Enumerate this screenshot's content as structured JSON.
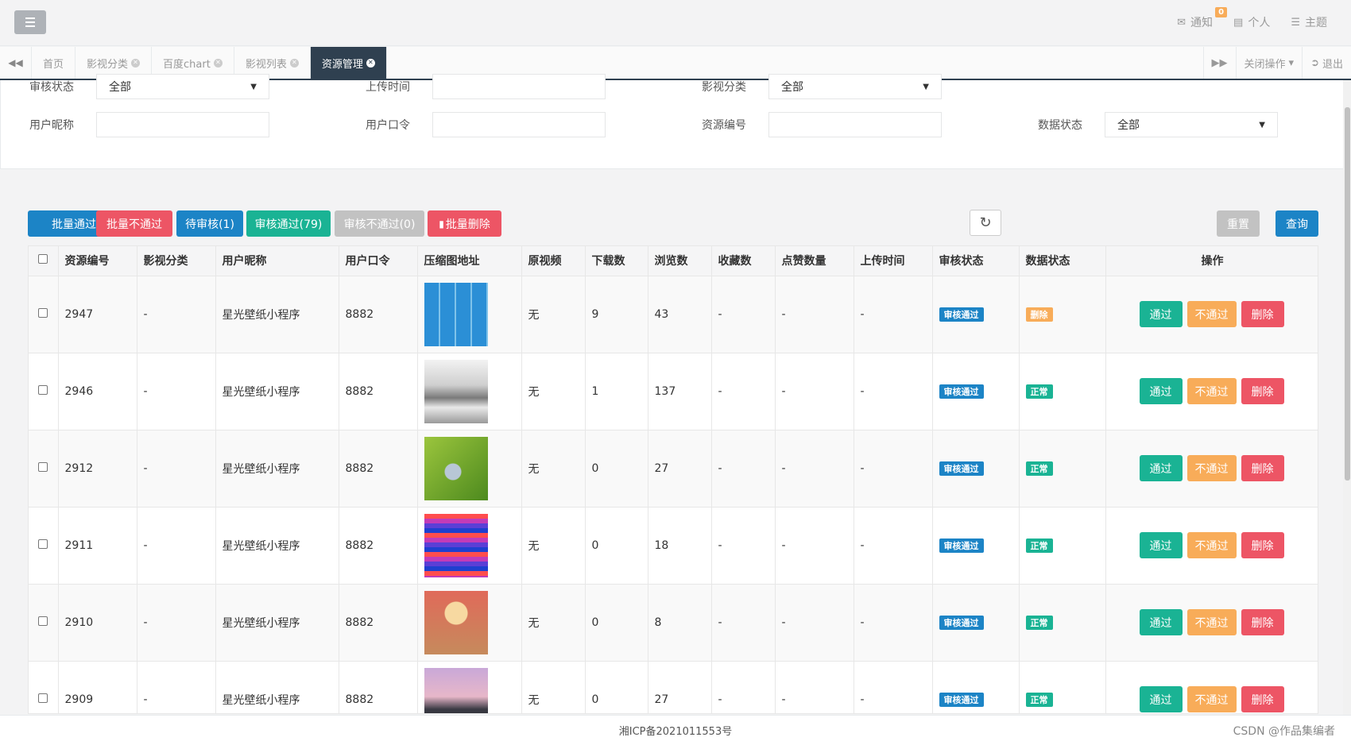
{
  "header": {
    "notify_label": "通知",
    "notify_count": "0",
    "profile_label": "个人",
    "theme_label": "主题"
  },
  "tabs": {
    "items": [
      {
        "label": "首页",
        "closable": false
      },
      {
        "label": "影视分类",
        "closable": true
      },
      {
        "label": "百度chart",
        "closable": true
      },
      {
        "label": "影视列表",
        "closable": true
      },
      {
        "label": "资源管理",
        "closable": true,
        "active": true
      }
    ],
    "close_ops_label": "关闭操作",
    "logout_label": "退出"
  },
  "search": {
    "audit_status": {
      "label": "审核状态",
      "value": "全部"
    },
    "upload_time": {
      "label": "上传时间",
      "value": ""
    },
    "category": {
      "label": "影视分类",
      "value": "全部"
    },
    "nickname": {
      "label": "用户昵称",
      "value": ""
    },
    "token": {
      "label": "用户口令",
      "value": ""
    },
    "resource_id": {
      "label": "资源编号",
      "value": ""
    },
    "data_status": {
      "label": "数据状态",
      "value": "全部"
    }
  },
  "toolbar": {
    "batch_pass": "批量通过",
    "batch_fail": "批量不通过",
    "pending": "待审核(1)",
    "passed": "审核通过(79)",
    "failed": "审核不通过(0)",
    "batch_delete": "批量删除",
    "reset": "重置",
    "query": "查询"
  },
  "table": {
    "columns": [
      "资源编号",
      "影视分类",
      "用户昵称",
      "用户口令",
      "压缩图地址",
      "原视频",
      "下载数",
      "浏览数",
      "收藏数",
      "点赞数量",
      "上传时间",
      "审核状态",
      "数据状态",
      "操作"
    ],
    "rows": [
      {
        "id": "2947",
        "category": "-",
        "nickname": "星光壁纸小程序",
        "token": "8882",
        "video": "无",
        "downloads": "9",
        "views": "43",
        "favorites": "-",
        "likes": "-",
        "upload_time": "-",
        "audit": "审核通过",
        "status": "删除",
        "status_color": "#f8ac59",
        "thumb": "blue-cubes"
      },
      {
        "id": "2946",
        "category": "-",
        "nickname": "星光壁纸小程序",
        "token": "8882",
        "video": "无",
        "downloads": "1",
        "views": "137",
        "favorites": "-",
        "likes": "-",
        "upload_time": "-",
        "audit": "审核通过",
        "status": "正常",
        "status_color": "#1ab394",
        "thumb": "ink-landscape"
      },
      {
        "id": "2912",
        "category": "-",
        "nickname": "星光壁纸小程序",
        "token": "8882",
        "video": "无",
        "downloads": "0",
        "views": "27",
        "favorites": "-",
        "likes": "-",
        "upload_time": "-",
        "audit": "审核通过",
        "status": "正常",
        "status_color": "#1ab394",
        "thumb": "butterfly-green"
      },
      {
        "id": "2911",
        "category": "-",
        "nickname": "星光壁纸小程序",
        "token": "8882",
        "video": "无",
        "downloads": "0",
        "views": "18",
        "favorites": "-",
        "likes": "-",
        "upload_time": "-",
        "audit": "审核通过",
        "status": "正常",
        "status_color": "#1ab394",
        "thumb": "gradient-stripes"
      },
      {
        "id": "2910",
        "category": "-",
        "nickname": "星光壁纸小程序",
        "token": "8882",
        "video": "无",
        "downloads": "0",
        "views": "8",
        "favorites": "-",
        "likes": "-",
        "upload_time": "-",
        "audit": "审核通过",
        "status": "正常",
        "status_color": "#1ab394",
        "thumb": "portrait-pink"
      },
      {
        "id": "2909",
        "category": "-",
        "nickname": "星光壁纸小程序",
        "token": "8882",
        "video": "无",
        "downloads": "0",
        "views": "27",
        "favorites": "-",
        "likes": "-",
        "upload_time": "-",
        "audit": "审核通过",
        "status": "正常",
        "status_color": "#1ab394",
        "thumb": "car-sunset"
      }
    ],
    "action_pass": "通过",
    "action_fail": "不通过",
    "action_delete": "删除"
  },
  "footer": {
    "icp": "湘ICP备2021011553号",
    "watermark": "CSDN @作品集编者"
  },
  "colors": {
    "primary_blue": "#1c84c6",
    "danger_red": "#ed5565",
    "success_green": "#1ab394",
    "warning_orange": "#f8ac59",
    "nav_dark": "#2f4050"
  }
}
